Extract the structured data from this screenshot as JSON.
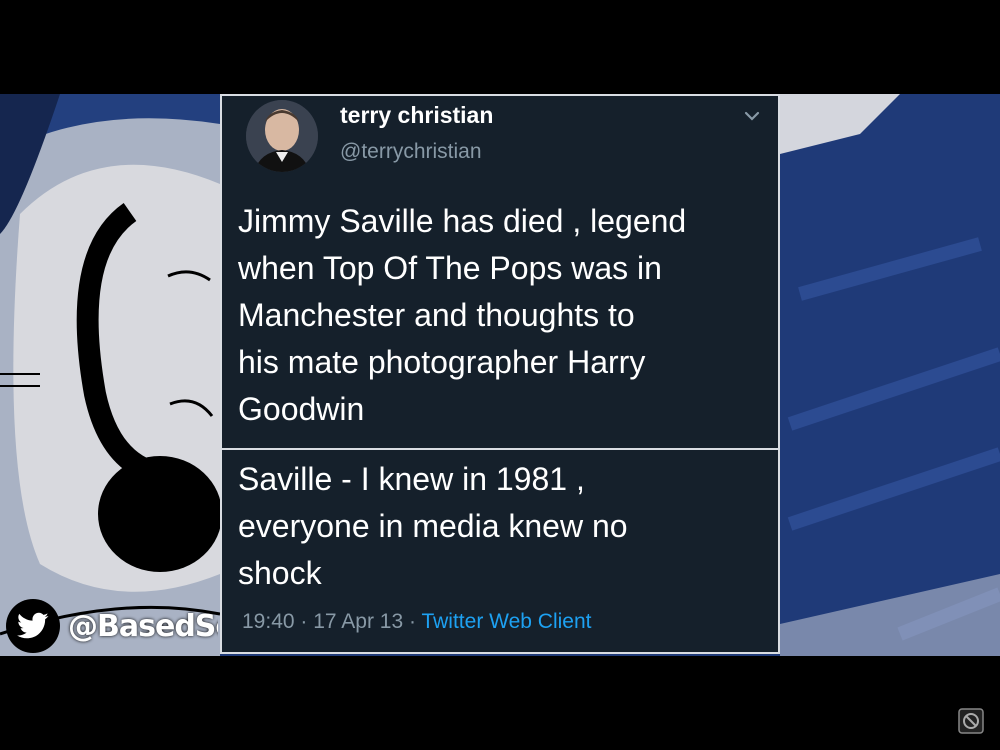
{
  "tweet": {
    "display_name": "terry christian",
    "handle": "@terrychristian",
    "text_main": "Jimmy Saville has died , legend\nwhen Top Of The Pops was in\nManchester and thoughts to\nhis mate photographer Harry\nGoodwin",
    "text_reply": "Saville - I knew in 1981 ,\neveryone in media knew no\nshock",
    "time": "19:40",
    "date": "17 Apr 13",
    "separator": "·",
    "client": "Twitter Web Client"
  },
  "watermark": {
    "text": "@BasedScot",
    "icon": "twitter-bird-icon"
  },
  "colors": {
    "tweet_bg": "#15202b",
    "text": "#ffffff",
    "muted": "#8899a6",
    "link": "#1da1f2",
    "video_bg": "#1f3a78"
  }
}
